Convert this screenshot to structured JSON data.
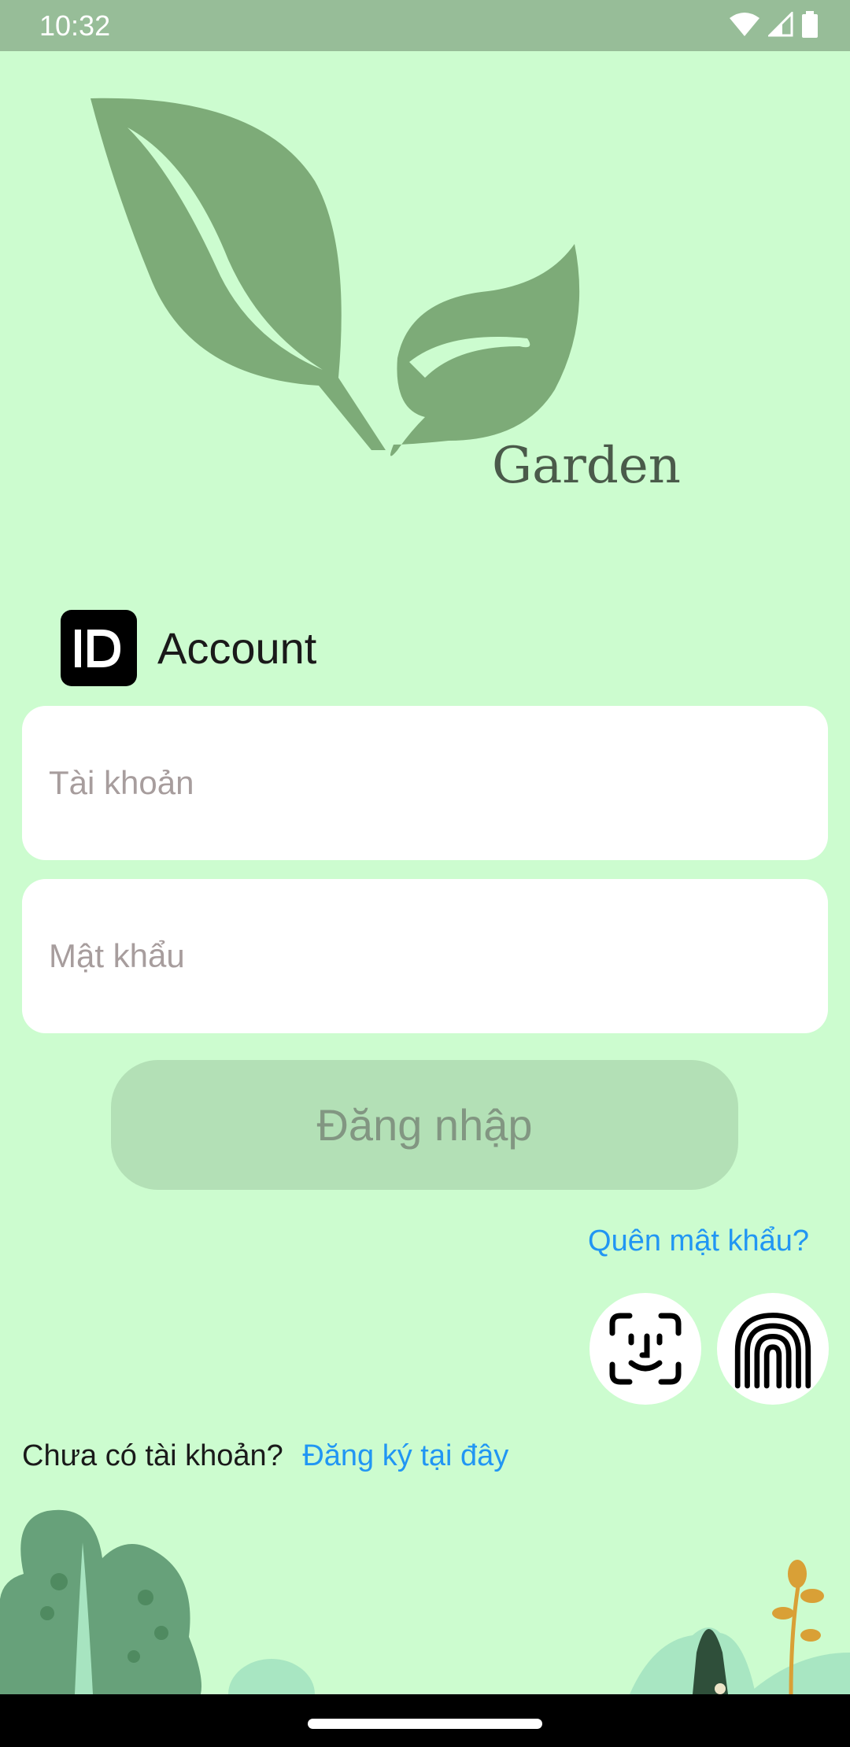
{
  "status_bar": {
    "time": "10:32"
  },
  "logo": {
    "text": "Garden"
  },
  "account": {
    "label": "Account",
    "badge": "ID"
  },
  "form": {
    "username_placeholder": "Tài khoản",
    "password_placeholder": "Mật khẩu",
    "login_label": "Đăng nhập",
    "forgot_label": "Quên mật khẩu?"
  },
  "biometrics": {
    "face_icon": "face-id-icon",
    "fingerprint_icon": "fingerprint-icon"
  },
  "register": {
    "prompt": "Chưa có tài khoản?",
    "link_label": "Đăng ký tại đây"
  },
  "colors": {
    "background": "#ccfccf",
    "status_bar": "#97bd98",
    "leaf": "#7dab78",
    "button": "#b3e0b6",
    "link": "#2196f3"
  }
}
